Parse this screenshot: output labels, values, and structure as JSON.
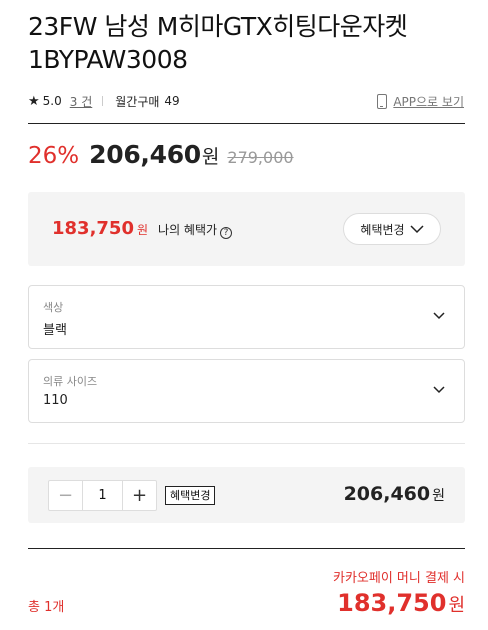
{
  "product": {
    "title_line1": "23FW 남성 M히마GTX히팅다운자켓",
    "title_line2": "1BYPAW3008"
  },
  "meta": {
    "star_glyph": "★",
    "rating": "5.0",
    "review_count": "3 건",
    "monthly_label": "월간구매",
    "monthly_count": "49",
    "app_link": "APP으로 보기"
  },
  "pricing": {
    "discount": "26%",
    "price": "206,460",
    "price_unit": "원",
    "original_price": "279,000"
  },
  "benefit": {
    "price": "183,750",
    "unit": "원",
    "label": "나의 혜택가",
    "help_glyph": "?",
    "button_label": "혜택변경"
  },
  "options": [
    {
      "label": "색상",
      "value": "블랙"
    },
    {
      "label": "의류 사이즈",
      "value": "110"
    }
  ],
  "quantity": {
    "minus": "−",
    "value": "1",
    "plus": "+",
    "benefit_tag": "혜택변경",
    "row_total": "206,460",
    "row_total_unit": "원"
  },
  "summary": {
    "total_count": "총 1개",
    "kakao_note": "카카오페이 머니 결제 시",
    "final_price": "183,750",
    "final_unit": "원"
  },
  "colors": {
    "accent_red": "#e0302c",
    "panel_bg": "#f4f4f4",
    "border": "#dddddd"
  }
}
